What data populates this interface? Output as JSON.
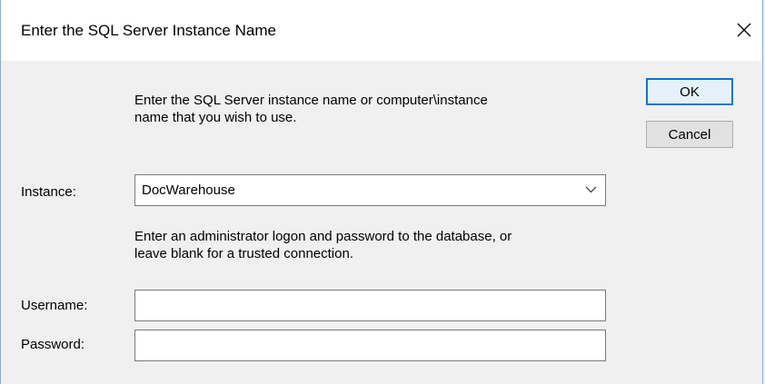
{
  "window": {
    "title": "Enter the SQL Server Instance Name"
  },
  "instructions": {
    "instance_line1": "Enter the SQL Server instance name or computer\\instance",
    "instance_line2": "name that you wish to use.",
    "logon_line1": "Enter an administrator logon and password to the database, or",
    "logon_line2": "leave blank for a trusted connection."
  },
  "fields": {
    "instance_label": "Instance:",
    "instance_value": "DocWarehouse",
    "username_label": "Username:",
    "username_value": "",
    "password_label": "Password:",
    "password_value": ""
  },
  "buttons": {
    "ok": "OK",
    "cancel": "Cancel"
  },
  "icons": {
    "close": "close-icon",
    "dropdown": "chevron-down-icon"
  },
  "colors": {
    "accent": "#0078d7",
    "window_bg": "#f0f0f0"
  }
}
